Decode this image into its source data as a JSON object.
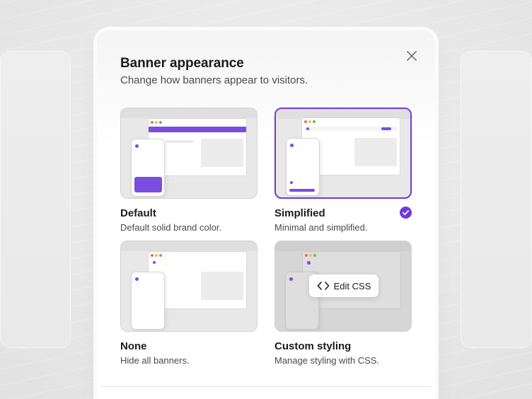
{
  "dialog": {
    "title": "Banner appearance",
    "subtitle": "Change how banners appear to visitors.",
    "close_icon": "close-icon"
  },
  "options": [
    {
      "id": "default",
      "label": "Default",
      "description": "Default solid brand color.",
      "selected": false
    },
    {
      "id": "simplified",
      "label": "Simplified",
      "description": "Minimal and simplified.",
      "selected": true
    },
    {
      "id": "none",
      "label": "None",
      "description": "Hide all banners.",
      "selected": false
    },
    {
      "id": "custom",
      "label": "Custom styling",
      "description": "Manage styling with CSS.",
      "selected": false
    }
  ],
  "custom": {
    "edit_css_label": "Edit CSS",
    "edit_css_icon": "code-icon"
  },
  "colors": {
    "accent": "#6e3bd7",
    "brand_banner": "#7a4ce0"
  }
}
